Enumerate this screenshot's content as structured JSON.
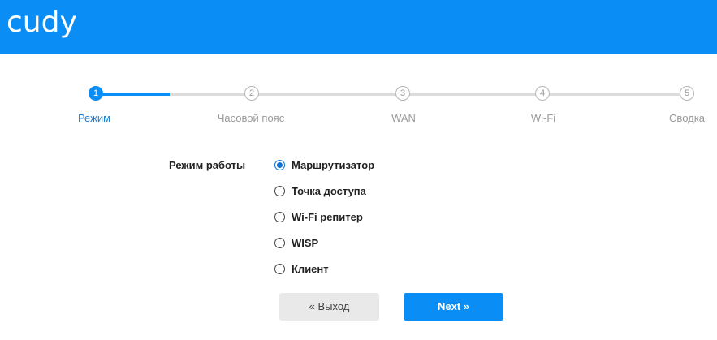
{
  "header": {
    "logo": "cudy"
  },
  "steps": [
    {
      "number": "1",
      "label": "Режим",
      "active": true
    },
    {
      "number": "2",
      "label": "Часовой пояс",
      "active": false
    },
    {
      "number": "3",
      "label": "WAN",
      "active": false
    },
    {
      "number": "4",
      "label": "Wi-Fi",
      "active": false
    },
    {
      "number": "5",
      "label": "Сводка",
      "active": false
    }
  ],
  "form": {
    "label": "Режим работы",
    "options": [
      {
        "label": "Маршрутизатор",
        "checked": true
      },
      {
        "label": "Точка доступа",
        "checked": false
      },
      {
        "label": "Wi-Fi репитер",
        "checked": false
      },
      {
        "label": "WISP",
        "checked": false
      },
      {
        "label": "Клиент",
        "checked": false
      }
    ]
  },
  "buttons": {
    "exit": "« Выход",
    "next": "Next »"
  },
  "colors": {
    "brand": "#0a8ef5",
    "track": "#dcdcdc"
  }
}
